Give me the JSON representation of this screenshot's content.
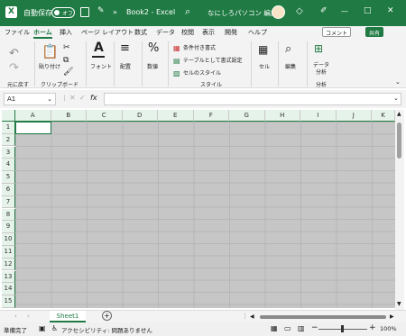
{
  "titlebar": {
    "autosave_label": "自動保存",
    "autosave_state": "オフ",
    "more_label": "»",
    "doc_title": "Book2 - Excel",
    "user_name": "なにしろパソコン 編集長",
    "window_controls": [
      "—",
      "□",
      "✕"
    ]
  },
  "menu": {
    "items": [
      "ファイル",
      "ホーム",
      "挿入",
      "ページ レイアウト",
      "数式",
      "データ",
      "校閲",
      "表示",
      "開発",
      "ヘルプ"
    ],
    "active_index": 1,
    "comment_label": "コメント",
    "share_label": "共有"
  },
  "ribbon": {
    "undo_group": "元に戻す",
    "paste_label": "貼り付け",
    "clipboard_group": "クリップボード",
    "font_label": "フォント",
    "align_label": "配置",
    "number_label": "数値",
    "cond_format": "条件付き書式",
    "table_format": "テーブルとして書式設定",
    "cell_style": "セルのスタイル",
    "style_group": "スタイル",
    "cells_label": "セル",
    "edit_label": "編集",
    "data_analysis_line1": "データ",
    "data_analysis_line2": "分析",
    "analysis_group": "分析"
  },
  "formula": {
    "namebox": "A1",
    "fx": "fx",
    "value": ""
  },
  "grid": {
    "columns": [
      "A",
      "B",
      "C",
      "D",
      "E",
      "F",
      "G",
      "H",
      "I",
      "J",
      "K"
    ],
    "rows": [
      "1",
      "2",
      "3",
      "4",
      "5",
      "6",
      "7",
      "8",
      "9",
      "10",
      "11",
      "12",
      "13",
      "14",
      "15"
    ],
    "selected_cell": "A1"
  },
  "sheets": {
    "tabs": [
      "Sheet1"
    ],
    "add_label": "+"
  },
  "status": {
    "ready": "準備完了",
    "accessibility": "アクセシビリティ: 問題ありません",
    "zoom": "100%"
  },
  "colors": {
    "accent": "#1f7a43",
    "grid_fill": "#c6c6c6"
  }
}
